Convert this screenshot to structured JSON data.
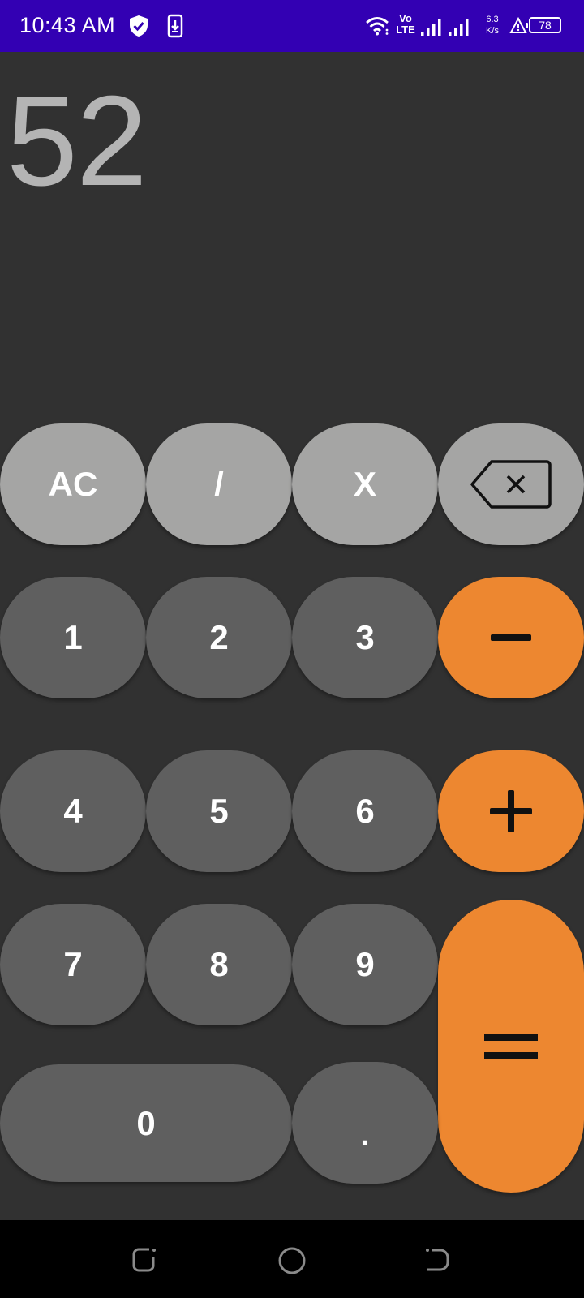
{
  "status_bar": {
    "time": "10:43 AM",
    "network_top": "Vo",
    "network_bottom": "LTE",
    "speed_value": "6.3",
    "speed_unit": "K/s",
    "battery": "78",
    "bg_color": "#3300b3",
    "icons": [
      "shield-check-icon",
      "download-icon",
      "wifi-icon",
      "signal-icon",
      "signal-icon",
      "warning-icon",
      "battery-icon"
    ]
  },
  "display": {
    "value": "52",
    "color": "#b4b4b4"
  },
  "keypad": {
    "ac": "AC",
    "divide": "/",
    "multiply": "X",
    "backspace_icon": "backspace-icon",
    "one": "1",
    "two": "2",
    "three": "3",
    "minus_icon": "minus-icon",
    "four": "4",
    "five": "5",
    "six": "6",
    "plus_icon": "plus-icon",
    "seven": "7",
    "eight": "8",
    "nine": "9",
    "equals_icon": "equals-icon",
    "zero": "0",
    "decimal": "."
  },
  "colors": {
    "background": "#313131",
    "operator_key": "#a5a5a4",
    "number_key": "#5f5f5f",
    "accent_key": "#ed8730"
  },
  "nav_bar": {
    "icons": [
      "recent-apps-icon",
      "home-icon",
      "back-icon"
    ]
  }
}
